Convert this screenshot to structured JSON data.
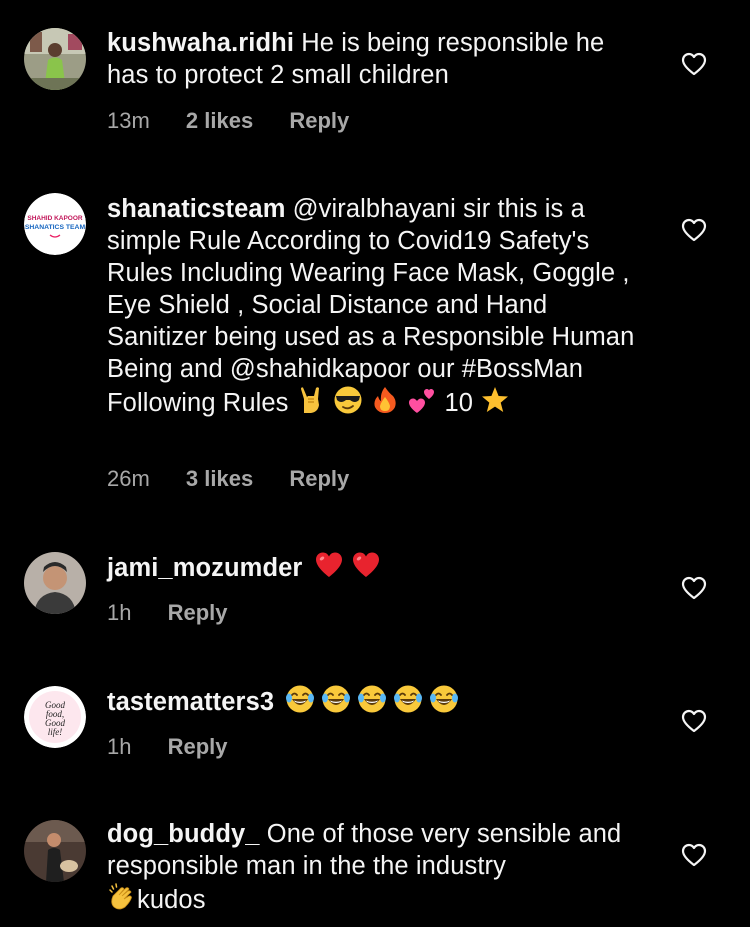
{
  "comments": [
    {
      "username": "kushwaha.ridhi",
      "text": "He is being responsible he has to protect 2 small children",
      "time": "13m",
      "likes": "2 likes",
      "reply": "Reply"
    },
    {
      "username": "shanaticsteam",
      "text": "@viralbhayani sir this is a simple Rule According to Covid19 Safety's Rules Including Wearing Face Mask, Goggle , Eye Shield , Social Distance and Hand Sanitizer being used as a Responsible Human Being and @shahidkapoor our #BossMan Following Rules",
      "text_tail": "10",
      "avatar_text_top": "SHAHID KAPOOR",
      "avatar_text_main": "SHANATICS TEAM",
      "time": "26m",
      "likes": "3 likes",
      "reply": "Reply"
    },
    {
      "username": "jami_mozumder",
      "time": "1h",
      "reply": "Reply"
    },
    {
      "username": "tastematters3",
      "avatar_text": [
        "Good",
        "food,",
        "Good",
        "life!"
      ],
      "time": "1h",
      "reply": "Reply"
    },
    {
      "username": "dog_buddy_",
      "text": "One of those very sensible and responsible man in the the industry",
      "text_tail": "kudos"
    }
  ],
  "icons": {
    "like": "heart-outline-icon",
    "emoji_rock": "sign-of-horns-emoji",
    "emoji_cool": "sunglasses-emoji",
    "emoji_fire": "fire-emoji",
    "emoji_hearts": "two-hearts-emoji",
    "emoji_star": "star-emoji",
    "emoji_heart": "red-heart-emoji",
    "emoji_laugh": "tears-of-joy-emoji",
    "emoji_clap": "clapping-hands-emoji"
  },
  "colors": {
    "background": "#000000",
    "text": "#f5f5f5",
    "meta": "#a8a8a8"
  }
}
